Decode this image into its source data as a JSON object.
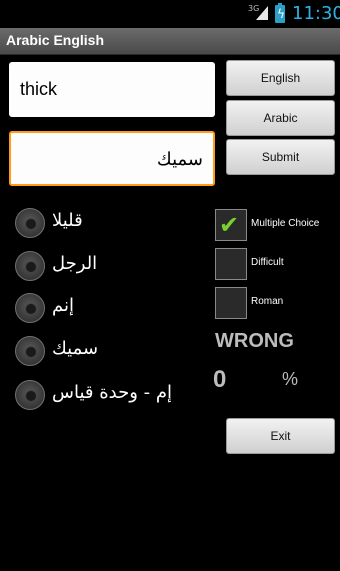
{
  "status_bar": {
    "network": "3G",
    "time": "11:30",
    "icons": [
      "signal-icon",
      "battery-charging-icon"
    ]
  },
  "app": {
    "title": "Arabic English"
  },
  "fields": {
    "english_value": "thick",
    "arabic_value": "سميك"
  },
  "buttons": {
    "english": "English",
    "arabic": "Arabic",
    "submit": "Submit",
    "exit": "Exit"
  },
  "choices": [
    {
      "label": "قليلا",
      "selected": false
    },
    {
      "label": "الرجل",
      "selected": false
    },
    {
      "label": "إنم",
      "selected": false
    },
    {
      "label": "سميك",
      "selected": false
    },
    {
      "label": "إم - وحدة قياس",
      "selected": false
    }
  ],
  "options": [
    {
      "label": "Multiple Choice",
      "checked": true
    },
    {
      "label": "Difficult",
      "checked": false
    },
    {
      "label": "Roman",
      "checked": false
    }
  ],
  "result": {
    "status": "WRONG",
    "score": "0",
    "unit": "%"
  },
  "colors": {
    "accent": "#2fb1e0",
    "focus": "#ff9c1a",
    "check": "#7ad030"
  }
}
